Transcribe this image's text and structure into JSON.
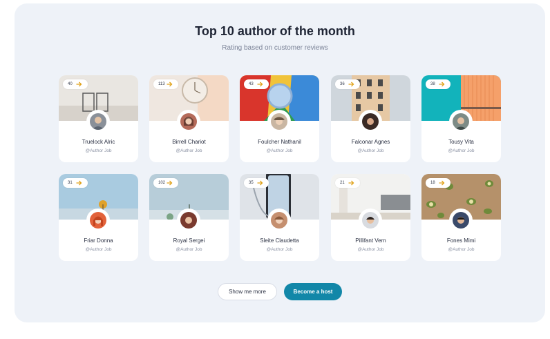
{
  "header": {
    "title": "Top 10 author of the month",
    "subtitle": "Rating based on customer reviews"
  },
  "authors": [
    {
      "name": "Truelock Alric",
      "job": "@Author Job",
      "count": "40"
    },
    {
      "name": "Birrell Chariot",
      "job": "@Author Job",
      "count": "113"
    },
    {
      "name": "Foulcher Nathanil",
      "job": "@Author Job",
      "count": "43"
    },
    {
      "name": "Falconar Agnes",
      "job": "@Author Job",
      "count": "36"
    },
    {
      "name": "Tousy Vita",
      "job": "@Author Job",
      "count": "38"
    },
    {
      "name": "Friar Donna",
      "job": "@Author Job",
      "count": "31"
    },
    {
      "name": "Royal Sergei",
      "job": "@Author Job",
      "count": "102"
    },
    {
      "name": "Sleite Claudetta",
      "job": "@Author Job",
      "count": "35"
    },
    {
      "name": "Pillifant Vern",
      "job": "@Author Job",
      "count": "21"
    },
    {
      "name": "Fones Mimi",
      "job": "@Author Job",
      "count": "18"
    }
  ],
  "actions": {
    "show_more": "Show me more",
    "become_host": "Become a host"
  },
  "colors": {
    "panel": "#eef2f8",
    "primary_button": "#1287a8",
    "arrow_accent": "#e0a21a"
  },
  "icons": {
    "badge": "arrow-right-icon"
  }
}
